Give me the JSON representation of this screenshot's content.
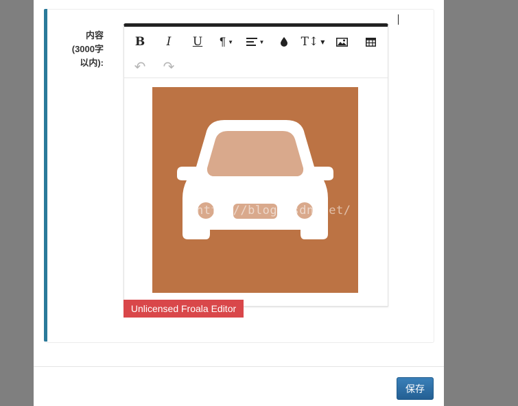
{
  "form": {
    "label_lines": [
      "内容",
      "(3000字",
      "以内):"
    ]
  },
  "editor": {
    "toolbar": {
      "buttons": [
        {
          "name": "bold-button",
          "glyph": "B",
          "icon": "bold-icon"
        },
        {
          "name": "italic-button",
          "glyph": "I",
          "icon": "italic-icon"
        },
        {
          "name": "underline-button",
          "glyph": "U",
          "icon": "underline-icon"
        },
        {
          "name": "paragraph-format-button",
          "glyph": "¶",
          "icon": "paragraph-icon"
        },
        {
          "name": "align-button",
          "glyph": "≡",
          "icon": "align-left-icon"
        },
        {
          "name": "color-button",
          "glyph": "●",
          "icon": "color-drop-icon"
        },
        {
          "name": "font-size-button",
          "glyph": "T↕",
          "icon": "font-size-icon"
        },
        {
          "name": "insert-image-button",
          "glyph": "",
          "icon": "image-icon"
        },
        {
          "name": "insert-table-button",
          "glyph": "",
          "icon": "table-icon"
        },
        {
          "name": "undo-button",
          "glyph": "↶",
          "icon": "undo-icon"
        },
        {
          "name": "redo-button",
          "glyph": "↷",
          "icon": "redo-icon"
        }
      ]
    },
    "image": {
      "alt": "car icon",
      "background_color": "#bc7344",
      "watermark": "http://blog.csdn.net/"
    },
    "license_badge": "Unlicensed Froala Editor"
  },
  "footer": {
    "save_label": "保存"
  },
  "colors": {
    "accent": "#2a7a9a",
    "badge": "#d9474a",
    "primary_button": "#2b6fa6"
  }
}
